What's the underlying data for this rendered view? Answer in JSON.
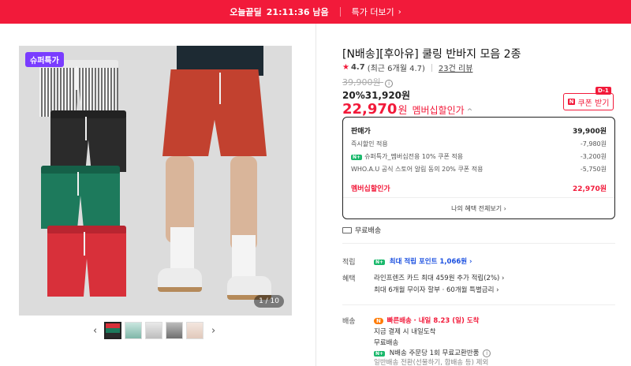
{
  "topbar": {
    "deal_label": "오늘끝딜",
    "timer": "21:11:36 남음",
    "more_label": "특가 더보기",
    "more_chevron": "›"
  },
  "gallery": {
    "badge": "슈퍼특가",
    "counter": "1 / 10",
    "prev_arrow": "‹",
    "next_arrow": "›",
    "thumb_count": 5,
    "colors": {
      "stripe": "#777777",
      "black": "#2b2b2b",
      "green": "#1d7a5c",
      "red": "#d8303a",
      "model_shorts": "#c2412f"
    }
  },
  "product": {
    "title": "[N배송][후아유] 쿨링 반바지 모음 2종",
    "rating": "4.7",
    "rating_note": "(최근 6개월 4.7)",
    "reviews": "23건 리뷰",
    "original_price": "39,900원",
    "discount": "20%31,920원",
    "member_price": "22,970",
    "member_won": "원",
    "member_label": "멤버십할인가",
    "coupon_label": "쿠폰 받기",
    "coupon_dday": "D-1"
  },
  "pricebox": {
    "rows": [
      {
        "label": "판매가",
        "value": "39,900원"
      },
      {
        "label": "즉시할인 적용",
        "value": "-7,980원"
      },
      {
        "label": "슈퍼특가_멤버십전용 10% 쿠폰 적용",
        "value": "-3,200원"
      },
      {
        "label": "WHO.A.U 공식 스토어 알림 동의 20% 쿠폰 적용",
        "value": "-5,750원"
      },
      {
        "label": "멤버십할인가",
        "value": "22,970원"
      }
    ],
    "more": "나의 혜택 전체보기 ›"
  },
  "shipping_free": "무료배송",
  "points": {
    "label": "적립",
    "text": "최대 적립 포인트 1,066원 ›"
  },
  "benefits": {
    "label": "혜택",
    "line1": "라인프렌즈 카드 최대 459원 추가 적립(2%) ›",
    "line2": "최대 6개월 무이자 할부 · 60개월 특별금리 ›"
  },
  "delivery": {
    "label": "배송",
    "badge": "N",
    "arrival_brand": "빠른배송",
    "arrival": "· 내일 8.23 (일) 도착",
    "line2": "지금 결제 시 내일도착",
    "line3": "무료배송",
    "line4": "N배송 주문당 1회 무료교환반품",
    "line5": "일반배송 전환(선물하기, 합배송 등) 제외"
  }
}
